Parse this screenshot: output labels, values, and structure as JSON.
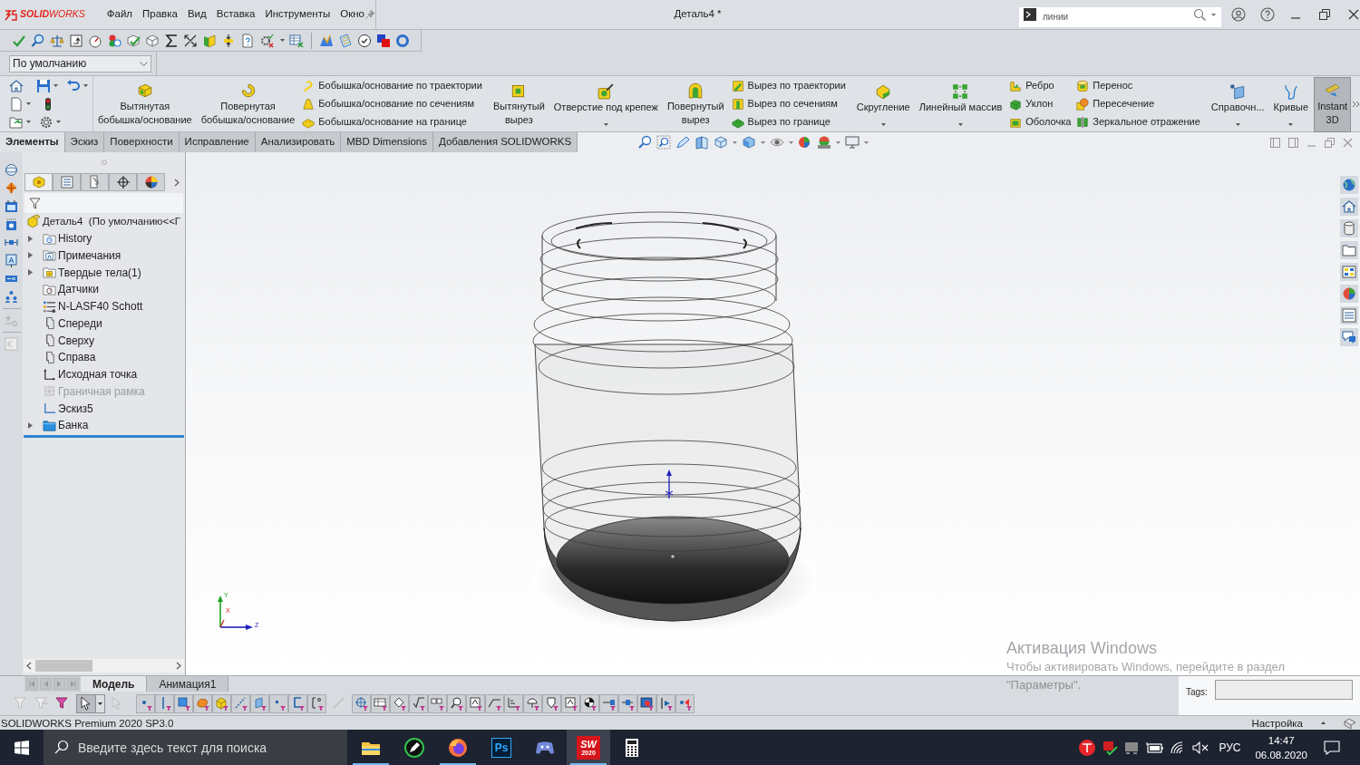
{
  "title_bar": {
    "logo": "**SOLID**WORKS",
    "menu": [
      "Файл",
      "Правка",
      "Вид",
      "Вставка",
      "Инструменты",
      "Окно"
    ],
    "document_title": "Деталь4 *",
    "search": {
      "value": "линии"
    }
  },
  "configuration": {
    "value": "По умолчанию"
  },
  "ribbon": [
    {
      "kind": "large",
      "label": "Вытянутая бобышка/основание",
      "dropdown": false,
      "pressed": false
    },
    {
      "kind": "large",
      "label": "Повернутая бобышка/основание",
      "dropdown": false,
      "pressed": false
    },
    {
      "kind": "stack",
      "items": [
        "Бобышка/основание по траектории",
        "Бобышка/основание по сечениям",
        "Бобышка/основание на границе"
      ]
    },
    {
      "kind": "separator"
    },
    {
      "kind": "large",
      "label": "Вытянутый вырез",
      "dropdown": false,
      "pressed": false
    },
    {
      "kind": "large",
      "label": "Отверстие под крепеж",
      "dropdown": true,
      "pressed": false
    },
    {
      "kind": "large",
      "label": "Повернутый вырез",
      "dropdown": false,
      "pressed": false
    },
    {
      "kind": "stack",
      "items": [
        "Вырез по траектории",
        "Вырез по сечениям",
        "Вырез по границе"
      ]
    },
    {
      "kind": "separator"
    },
    {
      "kind": "large",
      "label": "Скругление",
      "dropdown": true,
      "pressed": false
    },
    {
      "kind": "large",
      "label": "Линейный массив",
      "dropdown": true,
      "pressed": false
    },
    {
      "kind": "stack",
      "items": [
        "Ребро",
        "Уклон",
        "Оболочка"
      ]
    },
    {
      "kind": "stack",
      "items": [
        "Перенос",
        "Пересечение",
        "Зеркальное отражение"
      ]
    },
    {
      "kind": "separator"
    },
    {
      "kind": "large",
      "label": "Справочн...",
      "dropdown": true,
      "pressed": false
    },
    {
      "kind": "large",
      "label": "Кривые",
      "dropdown": true,
      "pressed": false
    },
    {
      "kind": "large",
      "label": "Instant 3D",
      "dropdown": false,
      "pressed": true
    }
  ],
  "tabs": [
    {
      "label": "Элементы",
      "selected": true
    },
    {
      "label": "Эскиз",
      "selected": false
    },
    {
      "label": "Поверхности",
      "selected": false
    },
    {
      "label": "Исправление",
      "selected": false
    },
    {
      "label": "Анализировать",
      "selected": false
    },
    {
      "label": "MBD Dimensions",
      "selected": false
    },
    {
      "label": "Добавления SOLIDWORKS",
      "selected": false
    }
  ],
  "feature_manager": {
    "tabs": [
      {
        "kind": "features",
        "selected": true
      },
      {
        "kind": "properties",
        "selected": false
      },
      {
        "kind": "configurations",
        "selected": false
      },
      {
        "kind": "dimxpert",
        "selected": false
      },
      {
        "kind": "display",
        "selected": false
      }
    ],
    "root": "Деталь4  (По умолчанию<<Г",
    "items": [
      {
        "kind": "history",
        "label": "History",
        "expandable": true,
        "disabled": false
      },
      {
        "kind": "annotations",
        "label": "Примечания",
        "expandable": true,
        "disabled": false
      },
      {
        "kind": "solid_bodies",
        "label": "Твердые тела(1)",
        "expandable": true,
        "disabled": false
      },
      {
        "kind": "sensors",
        "label": "Датчики",
        "expandable": false,
        "disabled": false
      },
      {
        "kind": "material",
        "label": "N-LASF40 Schott",
        "expandable": false,
        "disabled": false
      },
      {
        "kind": "plane",
        "label": "Спереди",
        "expandable": false,
        "disabled": false
      },
      {
        "kind": "plane",
        "label": "Сверху",
        "expandable": false,
        "disabled": false
      },
      {
        "kind": "plane",
        "label": "Справа",
        "expandable": false,
        "disabled": false
      },
      {
        "kind": "origin",
        "label": "Исходная точка",
        "expandable": false,
        "disabled": false
      },
      {
        "kind": "bounding_box",
        "label": "Граничная рамка",
        "expandable": false,
        "disabled": true
      },
      {
        "kind": "sketch",
        "label": "Эскиз5",
        "expandable": false,
        "disabled": false
      },
      {
        "kind": "folder",
        "label": "Банка",
        "expandable": true,
        "disabled": false
      }
    ]
  },
  "triad": {
    "y": "Y",
    "x": "X",
    "z": "Z"
  },
  "model_tabs": [
    {
      "label": "Модель",
      "selected": true
    },
    {
      "label": "Анимация1",
      "selected": false
    }
  ],
  "tags": {
    "label": "Tags:"
  },
  "status_bar": {
    "product": "SOLIDWORKS Premium 2020 SP3.0",
    "customize": "Настройка"
  },
  "activation_notice": {
    "title": "Активация Windows",
    "lines": [
      "Чтобы активировать Windows, перейдите в раздел",
      "\"Параметры\"."
    ]
  },
  "taskbar": {
    "search": {
      "placeholder": "Введите здесь текст для поиска"
    },
    "apps": [
      {
        "kind": "explorer",
        "running": true,
        "active": false
      },
      {
        "kind": "pen",
        "running": false,
        "active": false
      },
      {
        "kind": "browser",
        "running": true,
        "active": false
      },
      {
        "kind": "letters",
        "label": "Ps",
        "running": false,
        "active": false
      },
      {
        "kind": "chat",
        "running": false,
        "active": false
      },
      {
        "kind": "letters_red",
        "label": "SW",
        "sublabel": "2020",
        "running": true,
        "active": true
      },
      {
        "kind": "calculator",
        "running": false,
        "active": false
      }
    ],
    "tray": {
      "language": "РУС",
      "time": "14:47",
      "date": "06.08.2020"
    }
  }
}
